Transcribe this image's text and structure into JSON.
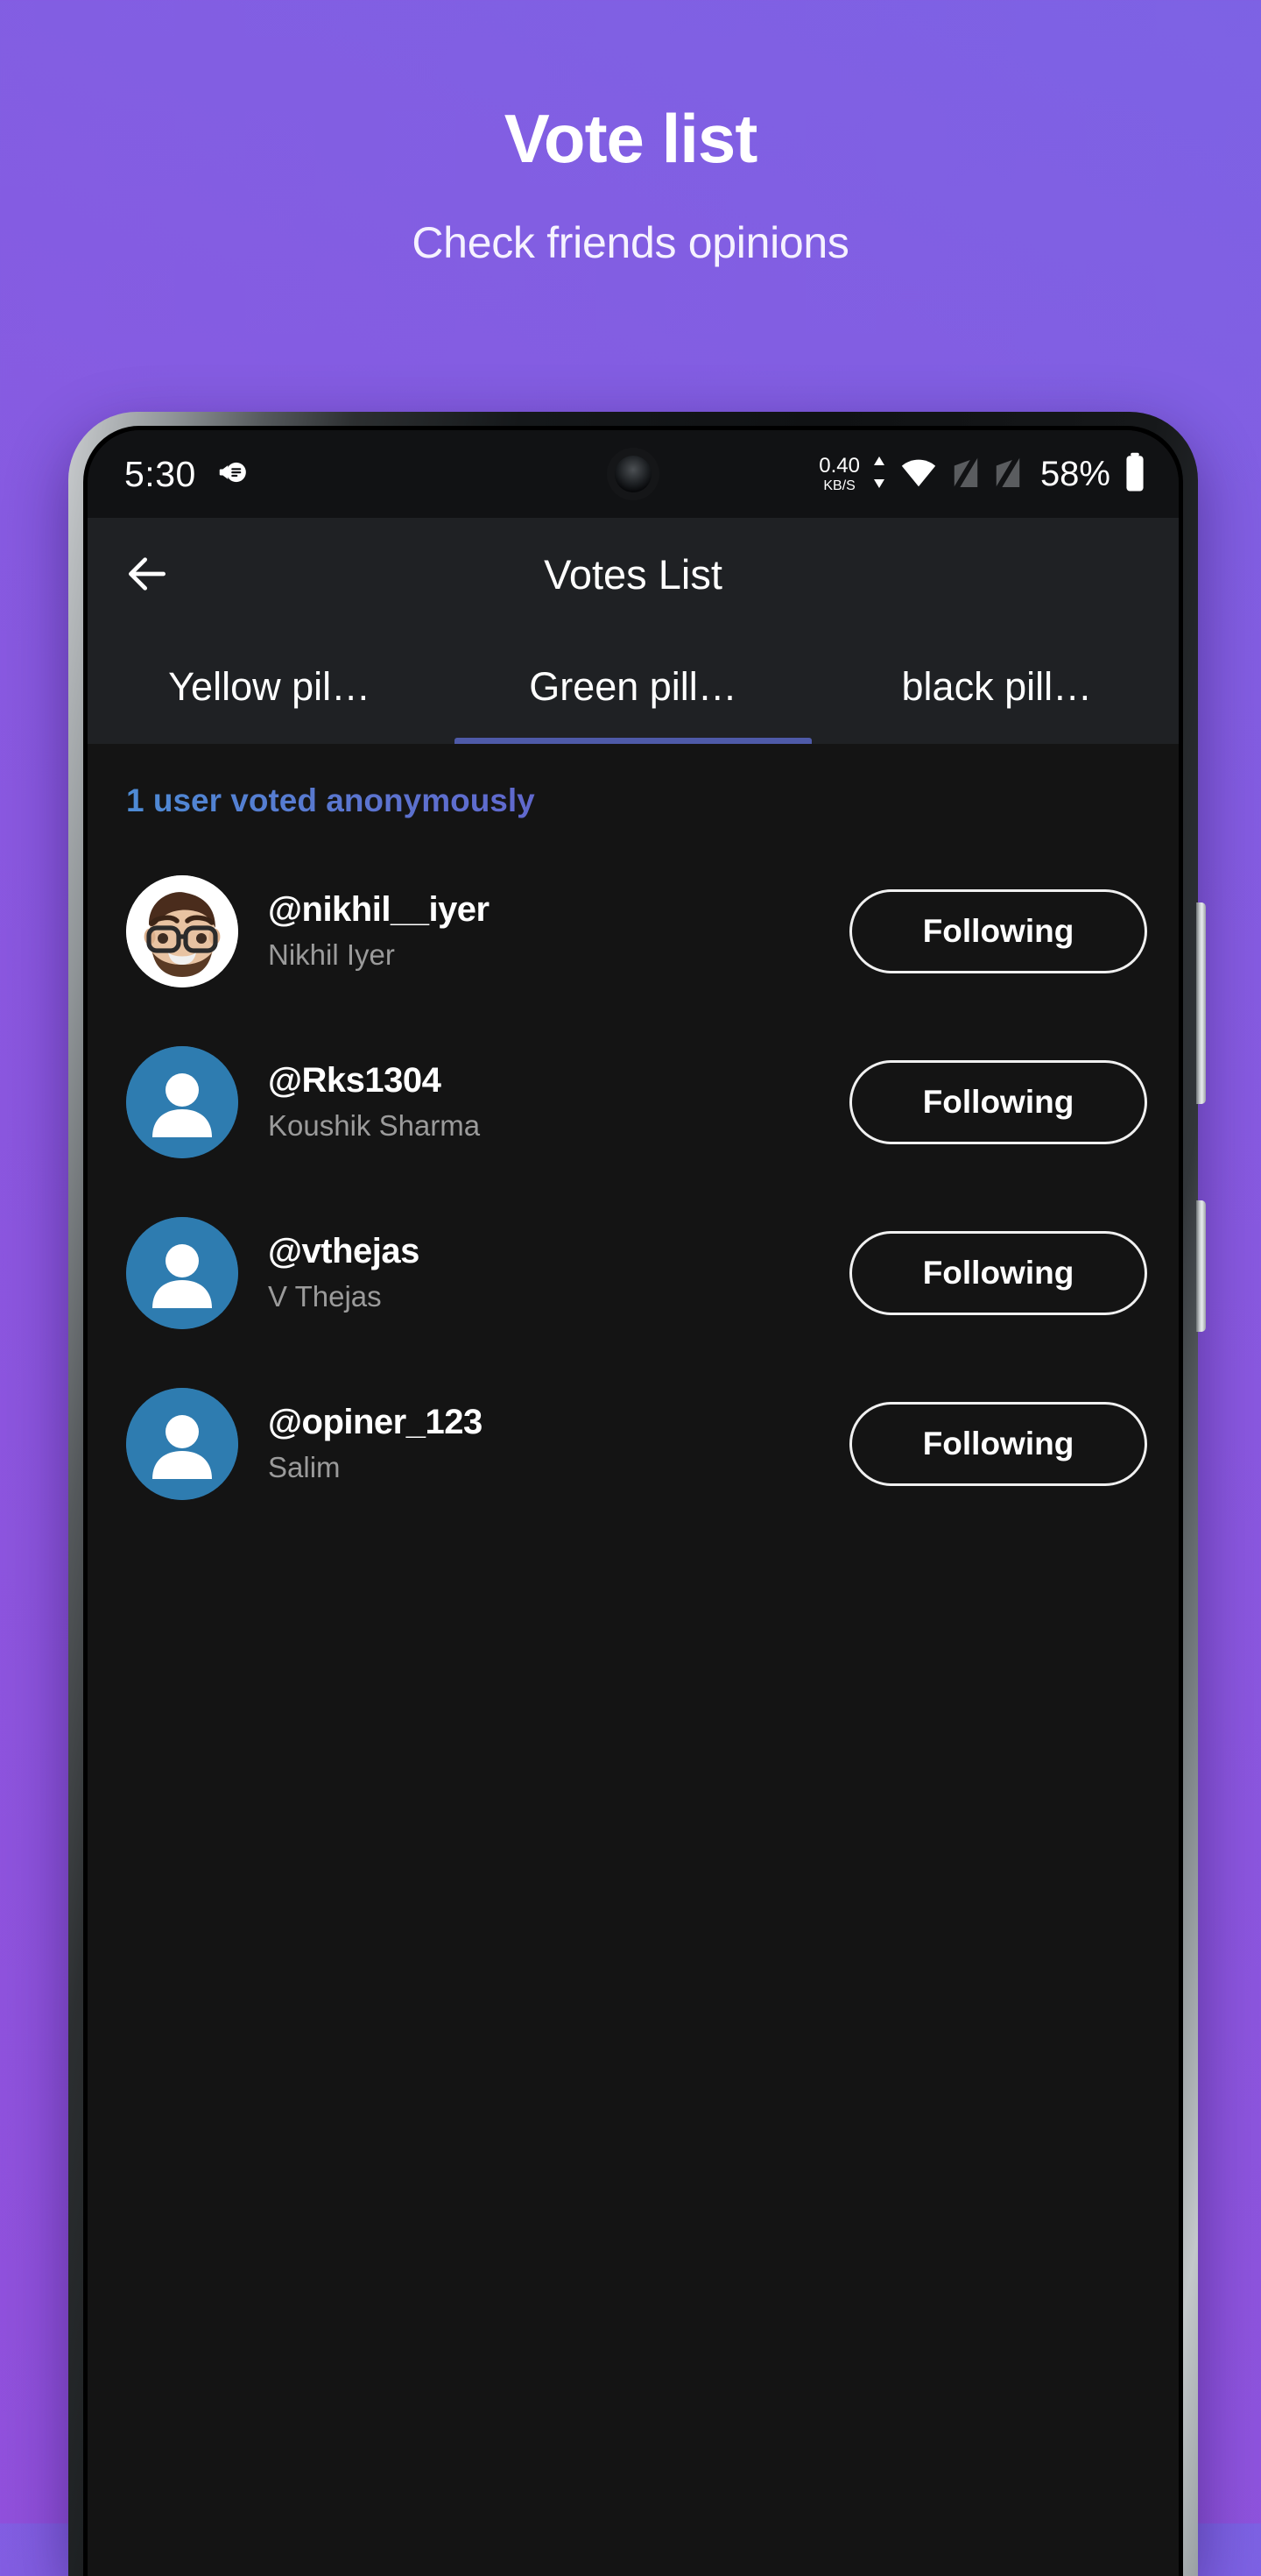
{
  "promo": {
    "title": "Vote list",
    "subtitle": "Check friends opinions"
  },
  "theme": {
    "bg_gradient_start": "#7d62e4",
    "bg_gradient_end": "#9150dc",
    "screen_bg": "#141414",
    "appbar_bg": "#1f2124",
    "tab_indicator": "#4e5aa8",
    "avatar_blue": "#2e7cb0",
    "anon_text_start": "#4b8fd6",
    "anon_text_end": "#6068cd"
  },
  "statusbar": {
    "time": "5:30",
    "notification_icon": "announcement-icon",
    "data_speed_value": "0.40",
    "data_speed_unit": "KB/S",
    "wifi_icon": "wifi-icon",
    "signal_icon_1": "signal-off-icon",
    "signal_icon_2": "signal-off-icon",
    "battery_percent": "58%",
    "battery_icon": "battery-icon"
  },
  "appbar": {
    "back_icon": "back-arrow-icon",
    "title": "Votes List"
  },
  "tabs": [
    {
      "label": "Yellow pil…",
      "active": false
    },
    {
      "label": "Green pill…",
      "active": true
    },
    {
      "label": "black pill…",
      "active": false
    }
  ],
  "content": {
    "anonymous_note": "1 user voted anonymously",
    "users": [
      {
        "handle": "@nikhil__iyer",
        "name": "Nikhil Iyer",
        "avatar_type": "memoji",
        "action_label": "Following"
      },
      {
        "handle": "@Rks1304",
        "name": "Koushik Sharma",
        "avatar_type": "default",
        "action_label": "Following"
      },
      {
        "handle": "@vthejas",
        "name": "V Thejas",
        "avatar_type": "default",
        "action_label": "Following"
      },
      {
        "handle": "@opiner_123",
        "name": "Salim",
        "avatar_type": "default",
        "action_label": "Following"
      }
    ]
  }
}
